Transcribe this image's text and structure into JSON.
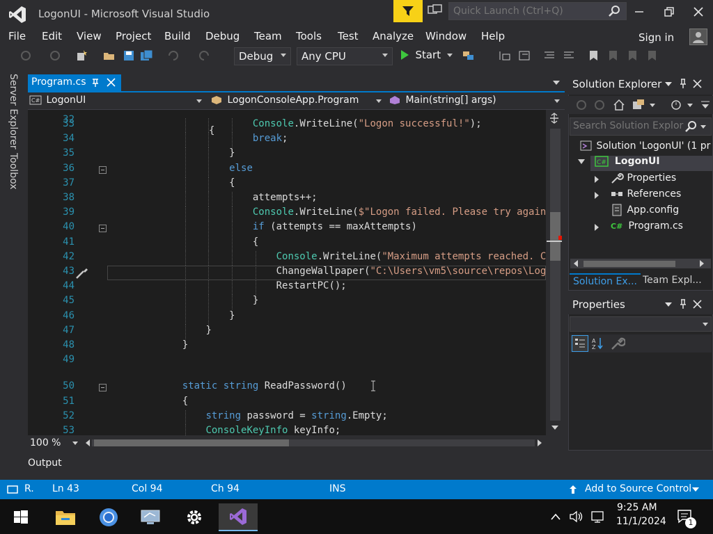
{
  "titlebar": {
    "title": "LogonUI - Microsoft Visual Studio",
    "quick_launch_placeholder": "Quick Launch (Ctrl+Q)"
  },
  "menu": {
    "items": [
      "File",
      "Edit",
      "View",
      "Project",
      "Build",
      "Debug",
      "Team",
      "Tools",
      "Test",
      "Analyze",
      "Window",
      "Help"
    ],
    "sign_in": "Sign in"
  },
  "toolbar": {
    "configuration": "Debug",
    "platform": "Any CPU",
    "start_label": "Start"
  },
  "side_panels": {
    "server_explorer": "Server Explorer",
    "toolbox": "Toolbox"
  },
  "document": {
    "tab_label": "Program.cs",
    "nav_project": "LogonUI",
    "nav_class": "LogonConsoleApp.Program",
    "nav_member": "Main(string[] args)",
    "zoom": "100 %"
  },
  "code": {
    "lines": [
      {
        "n": "33",
        "indent": 5,
        "parts": [
          [
            "ty",
            "Console"
          ],
          [
            "t",
            "."
          ],
          [
            "t",
            "WriteLine("
          ],
          [
            "str",
            "\"Logon successful!\""
          ],
          [
            "t",
            ");"
          ]
        ]
      },
      {
        "n": "34",
        "indent": 5,
        "parts": [
          [
            "kw",
            "break"
          ],
          [
            "t",
            ";"
          ]
        ]
      },
      {
        "n": "35",
        "indent": 4,
        "parts": [
          [
            "t",
            "}"
          ]
        ]
      },
      {
        "n": "36",
        "indent": 4,
        "parts": [
          [
            "kw",
            "else"
          ]
        ],
        "collapse": true
      },
      {
        "n": "37",
        "indent": 4,
        "parts": [
          [
            "t",
            "{"
          ]
        ]
      },
      {
        "n": "38",
        "indent": 5,
        "parts": [
          [
            "t",
            "attempts++;"
          ]
        ]
      },
      {
        "n": "39",
        "indent": 5,
        "parts": [
          [
            "ty",
            "Console"
          ],
          [
            "t",
            ".WriteLine("
          ],
          [
            "str",
            "$\"Logon failed. Please try again"
          ]
        ]
      },
      {
        "n": "40",
        "indent": 5,
        "parts": [
          [
            "kw",
            "if"
          ],
          [
            "t",
            " (attempts == maxAttempts)"
          ]
        ],
        "collapse": true
      },
      {
        "n": "41",
        "indent": 5,
        "parts": [
          [
            "t",
            "{"
          ]
        ]
      },
      {
        "n": "42",
        "indent": 6,
        "parts": [
          [
            "ty",
            "Console"
          ],
          [
            "t",
            ".WriteLine("
          ],
          [
            "str",
            "\"Maximum attempts reached. C"
          ]
        ]
      },
      {
        "n": "43",
        "indent": 6,
        "parts": [
          [
            "t",
            "ChangeWallpaper("
          ],
          [
            "str",
            "\"C:\\Users\\vm5\\source\\repos\\Log"
          ]
        ]
      },
      {
        "n": "44",
        "indent": 6,
        "parts": [
          [
            "t",
            "RestartPC();"
          ]
        ]
      },
      {
        "n": "45",
        "indent": 5,
        "parts": [
          [
            "t",
            "}"
          ]
        ]
      },
      {
        "n": "46",
        "indent": 4,
        "parts": [
          [
            "t",
            "}"
          ]
        ]
      },
      {
        "n": "47",
        "indent": 3,
        "parts": [
          [
            "t",
            "}"
          ]
        ]
      },
      {
        "n": "48",
        "indent": 2,
        "parts": [
          [
            "t",
            "}"
          ]
        ]
      },
      {
        "n": "49",
        "indent": 0,
        "parts": []
      },
      {
        "n": "50",
        "indent": 2,
        "parts": [
          [
            "kw",
            "static"
          ],
          [
            "t",
            " "
          ],
          [
            "kw",
            "string"
          ],
          [
            "t",
            " ReadPassword()"
          ]
        ],
        "collapse": true,
        "gap": true
      },
      {
        "n": "51",
        "indent": 2,
        "parts": [
          [
            "t",
            "{"
          ]
        ]
      },
      {
        "n": "52",
        "indent": 3,
        "parts": [
          [
            "kw",
            "string"
          ],
          [
            "t",
            " password = "
          ],
          [
            "kw",
            "string"
          ],
          [
            "t",
            ".Empty;"
          ]
        ]
      },
      {
        "n": "53",
        "indent": 3,
        "parts": [
          [
            "ty",
            "ConsoleKeyInfo"
          ],
          [
            "t",
            " keyInfo;"
          ]
        ]
      }
    ],
    "partial_top_line": "32"
  },
  "solution_explorer": {
    "title": "Solution Explorer",
    "search_placeholder": "Search Solution Explor",
    "items": [
      {
        "label": "Solution 'LogonUI' (1 pr",
        "icon": "solution-icon"
      },
      {
        "label": "LogonUI",
        "icon": "csharp-project-icon"
      },
      {
        "label": "Properties",
        "icon": "wrench-icon"
      },
      {
        "label": "References",
        "icon": "references-icon"
      },
      {
        "label": "App.config",
        "icon": "config-file-icon"
      },
      {
        "label": "Program.cs",
        "icon": "csharp-file-icon"
      }
    ],
    "tabs": [
      "Solution Ex...",
      "Team Expl..."
    ]
  },
  "properties": {
    "title": "Properties"
  },
  "output": {
    "title": "Output"
  },
  "status": {
    "ready": "R.",
    "line": "Ln 43",
    "col": "Col 94",
    "ch": "Ch 94",
    "mode": "INS",
    "source_control": "Add to Source Control"
  },
  "taskbar": {
    "time": "9:25 AM",
    "date": "11/1/2024",
    "notification_count": "1"
  },
  "colors": {
    "accent": "#007acc",
    "keyword": "#569cd6",
    "type": "#4ec9b0",
    "string": "#d69d85",
    "line_number": "#2b91af"
  }
}
